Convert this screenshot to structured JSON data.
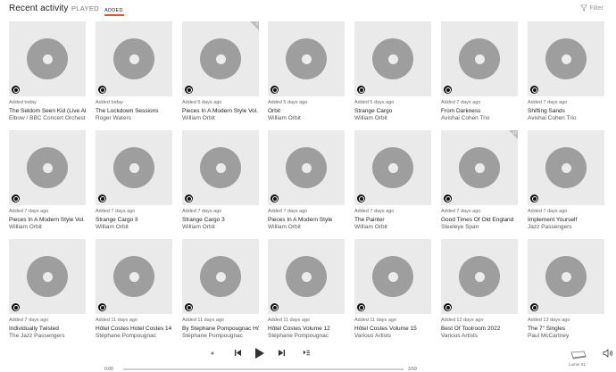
{
  "header": {
    "title": "Recent activity",
    "tabs": [
      "PLAYED",
      "ADDED"
    ],
    "filter_label": "Filter"
  },
  "albums": [
    {
      "added": "Added today",
      "name": "The Seldom Seen Kid (Live At",
      "artist": "Elbow / BBC Concert Orchestr"
    },
    {
      "added": "Added today",
      "name": "The Lockdown Sessions",
      "artist": "Roger Waters"
    },
    {
      "added": "Added 5 days ago",
      "name": "Pieces In A Modern Style Vol.",
      "artist": "William Orbit",
      "badge": "2"
    },
    {
      "added": "Added 5 days ago",
      "name": "Orbit",
      "artist": "William Orbit"
    },
    {
      "added": "Added 5 days ago",
      "name": "Strange Cargo",
      "artist": "William Orbit"
    },
    {
      "added": "Added 7 days ago",
      "name": "From Darkness",
      "artist": "Avishai Cohen Trio"
    },
    {
      "added": "Added 7 days ago",
      "name": "Shifting Sands",
      "artist": "Avishai Cohen Trio"
    },
    {
      "added": "Added 7 days ago",
      "name": "Pieces In A Modern Style Vol.",
      "artist": "William Orbit"
    },
    {
      "added": "Added 7 days ago",
      "name": "Strange Cargo II",
      "artist": "William Orbit"
    },
    {
      "added": "Added 7 days ago",
      "name": "Strange Cargo 3",
      "artist": "William Orbit"
    },
    {
      "added": "Added 7 days ago",
      "name": "Pieces In A Modern Style",
      "artist": "William Orbit"
    },
    {
      "added": "Added 7 days ago",
      "name": "The Painter",
      "artist": "William Orbit"
    },
    {
      "added": "Added 7 days ago",
      "name": "Good Times Of Old England",
      "artist": "Steeleye Span",
      "badge": "12"
    },
    {
      "added": "Added 7 days ago",
      "name": "Implement Yourself",
      "artist": "Jazz Passengers"
    },
    {
      "added": "Added 7 days ago",
      "name": "Individually Twisted",
      "artist": "The Jazz Passengers"
    },
    {
      "added": "Added 11 days ago",
      "name": "Hôtel Costes Hotel Costes 14",
      "artist": "Stéphane Pompougnac"
    },
    {
      "added": "Added 11 days ago",
      "name": "By Stephane Pompougnac Hô",
      "artist": "Stéphane Pompougnac"
    },
    {
      "added": "Added 11 days ago",
      "name": "Hôtel Costes Volume 12",
      "artist": "Stéphane Pompougnac"
    },
    {
      "added": "Added 11 days ago",
      "name": "Hôtel Costes Volume 15",
      "artist": "Various Artists"
    },
    {
      "added": "Added 12 days ago",
      "name": "Best Of Toolroom 2022",
      "artist": "Various Artists"
    },
    {
      "added": "Added 13 days ago",
      "name": "The 7\" Singles",
      "artist": "Paul McCartney"
    }
  ],
  "player": {
    "time_elapsed": "0:00",
    "time_total": "3:59",
    "progress": 0,
    "zone_name": "Lumin X1"
  },
  "colors": {
    "accent": "#e2502a",
    "art_bg": "#eaeaea",
    "disc": "#9e9e9e"
  }
}
